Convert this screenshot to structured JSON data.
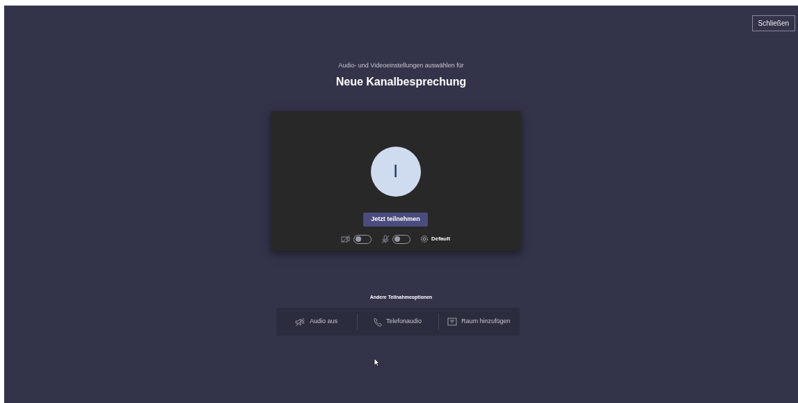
{
  "close_button": "Schließen",
  "subtitle": "Audio- und Videoeinstellungen auswählen für",
  "title": "Neue Kanalbesprechung",
  "preview": {
    "avatar_initial": "I",
    "join_button": "Jetzt teilnehmen",
    "toggles": [
      {
        "kind": "camera",
        "on": false
      },
      {
        "kind": "microphone",
        "on": false
      }
    ],
    "device_settings": "Default"
  },
  "other_options": {
    "heading": "Andere Teilnahmeoptionen",
    "items": [
      {
        "kind": "audio_off",
        "label": "Audio aus"
      },
      {
        "kind": "phone",
        "label": "Telefonaudio"
      },
      {
        "kind": "room",
        "label": "Raum hinzufügen"
      }
    ]
  }
}
